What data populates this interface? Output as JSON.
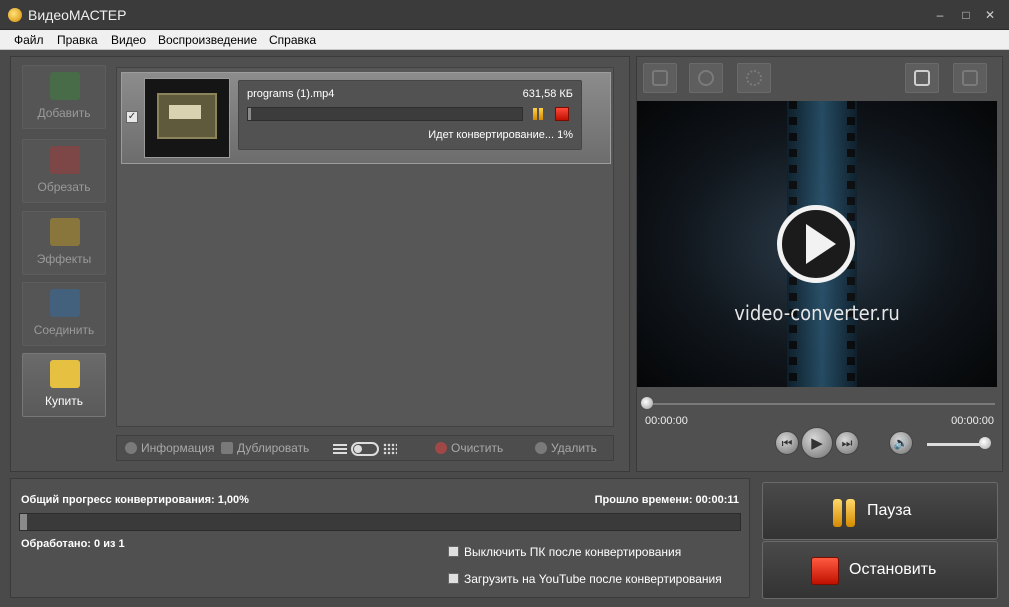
{
  "window": {
    "title": "ВидеоМАСТЕР",
    "minimize": "–",
    "maximize": "□",
    "close": "✕"
  },
  "menu": [
    "Файл",
    "Правка",
    "Видео",
    "Воспроизведение",
    "Справка"
  ],
  "sidebar": [
    {
      "label": "Добавить",
      "icon": "add-film-icon",
      "color": "#3a8a3a"
    },
    {
      "label": "Обрезать",
      "icon": "cut-film-icon",
      "color": "#b03838"
    },
    {
      "label": "Эффекты",
      "icon": "effects-star-icon",
      "color": "#c8a020"
    },
    {
      "label": "Соединить",
      "icon": "join-films-icon",
      "color": "#2f6fb0"
    },
    {
      "label": "Купить",
      "icon": "key-card-icon",
      "color": "#e6c040"
    }
  ],
  "file": {
    "checked": "✓",
    "name": "programs (1).mp4",
    "size": "631,58 КБ",
    "status": "Идет конвертирование... 1%",
    "progress": 0.01
  },
  "list_toolbar": {
    "info": "Информация",
    "duplicate": "Дублировать",
    "clear": "Очистить",
    "delete": "Удалить"
  },
  "player": {
    "brand": "video-converter.ru",
    "time_current": "00:00:00",
    "time_total": "00:00:00",
    "volume": 1.0,
    "seek": 0.0
  },
  "progress": {
    "overall_label": "Общий прогресс конвертирования: 1,00%",
    "elapsed_label": "Прошло времени: 00:00:11",
    "processed_label": "Обработано: 0 из 1",
    "value": 0.01
  },
  "options": {
    "shutdown": "Выключить ПК после конвертирования",
    "youtube": "Загрузить на YouTube после конвертирования"
  },
  "actions": {
    "pause": "Пауза",
    "stop": "Остановить"
  }
}
